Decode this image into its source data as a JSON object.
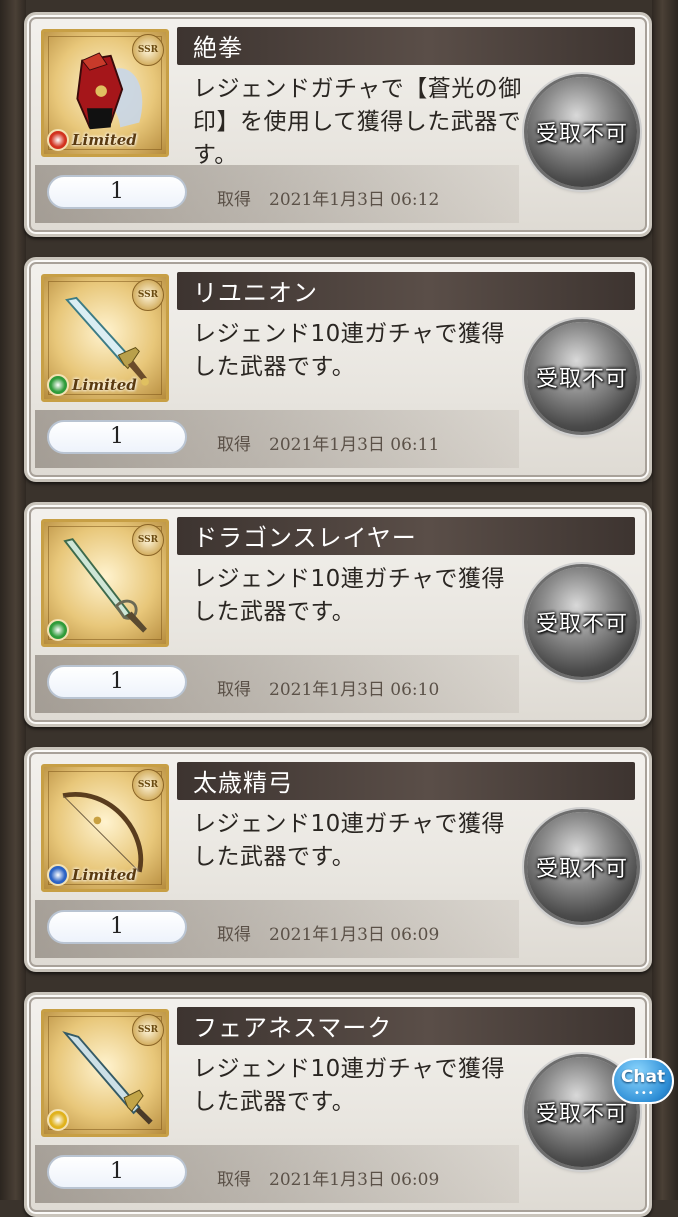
{
  "items": [
    {
      "name": "絶拳",
      "description": "レジェンドガチャで【蒼光の御印】を使用して獲得した武器です。",
      "quantity": "1",
      "acquired_label": "取得",
      "acquired_date": "2021年1月3日 06:12",
      "claim_label": "受取不可",
      "rarity": "SSR",
      "limited": "Limited",
      "element": "fire",
      "element_color": "#d2321f",
      "weapon_icon": "gauntlet-icon"
    },
    {
      "name": "リユニオン",
      "description": "レジェンド10連ガチャで獲得した武器です。",
      "quantity": "1",
      "acquired_label": "取得",
      "acquired_date": "2021年1月3日 06:11",
      "claim_label": "受取不可",
      "rarity": "SSR",
      "limited": "Limited",
      "element": "wind",
      "element_color": "#2f9b3a",
      "weapon_icon": "sword-icon"
    },
    {
      "name": "ドラゴンスレイヤー",
      "description": "レジェンド10連ガチャで獲得した武器です。",
      "quantity": "1",
      "acquired_label": "取得",
      "acquired_date": "2021年1月3日 06:10",
      "claim_label": "受取不可",
      "rarity": "SSR",
      "limited": "",
      "element": "wind",
      "element_color": "#2f9b3a",
      "weapon_icon": "sword-icon"
    },
    {
      "name": "太歳精弓",
      "description": "レジェンド10連ガチャで獲得した武器です。",
      "quantity": "1",
      "acquired_label": "取得",
      "acquired_date": "2021年1月3日 06:09",
      "claim_label": "受取不可",
      "rarity": "SSR",
      "limited": "Limited",
      "element": "water",
      "element_color": "#2c63c4",
      "weapon_icon": "bow-icon"
    },
    {
      "name": "フェアネスマーク",
      "description": "レジェンド10連ガチャで獲得した武器です。",
      "quantity": "1",
      "acquired_label": "取得",
      "acquired_date": "2021年1月3日 06:09",
      "claim_label": "受取不可",
      "rarity": "SSR",
      "limited": "",
      "element": "light",
      "element_color": "#e0b21c",
      "weapon_icon": "spear-icon"
    }
  ],
  "chat": {
    "label": "Chat"
  }
}
